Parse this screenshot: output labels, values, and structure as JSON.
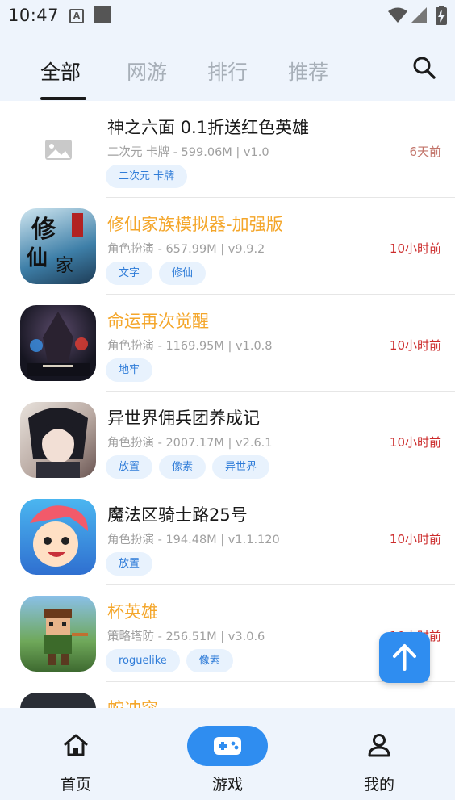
{
  "status": {
    "time": "10:47",
    "a_icon": "A"
  },
  "tabs": [
    {
      "label": "全部",
      "active": true
    },
    {
      "label": "网游",
      "active": false
    },
    {
      "label": "排行",
      "active": false
    },
    {
      "label": "推荐",
      "active": false
    }
  ],
  "games": [
    {
      "title": "神之六面 0.1折送红色英雄",
      "meta": "二次元 卡牌 - 599.06M | v1.0",
      "time": "6天前",
      "tags": [
        "二次元 卡牌"
      ],
      "icon": "image-placeholder-icon"
    },
    {
      "title": "修仙家族模拟器-加强版",
      "meta": "角色扮演 - 657.99M | v9.9.2",
      "time": "10小时前",
      "tags": [
        "文字",
        "修仙"
      ],
      "icon": "xiuxian-game-icon"
    },
    {
      "title": "命运再次觉醒",
      "meta": "角色扮演 - 1169.95M | v1.0.8",
      "time": "10小时前",
      "tags": [
        "地牢"
      ],
      "icon": "fate-reawakened-game-icon"
    },
    {
      "title": "异世界佣兵团养成记",
      "meta": "角色扮演 - 2007.17M | v2.6.1",
      "time": "10小时前",
      "tags": [
        "放置",
        "像素",
        "异世界"
      ],
      "icon": "mercenary-game-icon"
    },
    {
      "title": "魔法区骑士路25号",
      "meta": "角色扮演 - 194.48M | v1.1.120",
      "time": "10小时前",
      "tags": [
        "放置"
      ],
      "icon": "magic-knight-game-icon"
    },
    {
      "title": "杯英雄",
      "meta": "策略塔防 - 256.51M | v3.0.6",
      "time": "10小时前",
      "tags": [
        "roguelike",
        "像素"
      ],
      "icon": "cup-hero-game-icon"
    },
    {
      "title": "蛇冲突",
      "meta": "",
      "time": "",
      "tags": [],
      "icon": "snake-game-icon"
    }
  ],
  "bottom_nav": [
    {
      "label": "首页",
      "icon": "home-icon",
      "active": false
    },
    {
      "label": "游戏",
      "icon": "gamepad-icon",
      "active": true
    },
    {
      "label": "我的",
      "icon": "user-icon",
      "active": false
    }
  ],
  "colors": {
    "accent": "#2f8df0",
    "highlight_title": "#f4a62a",
    "time_red": "#cc2b2b",
    "header_bg": "#eef4fc"
  }
}
